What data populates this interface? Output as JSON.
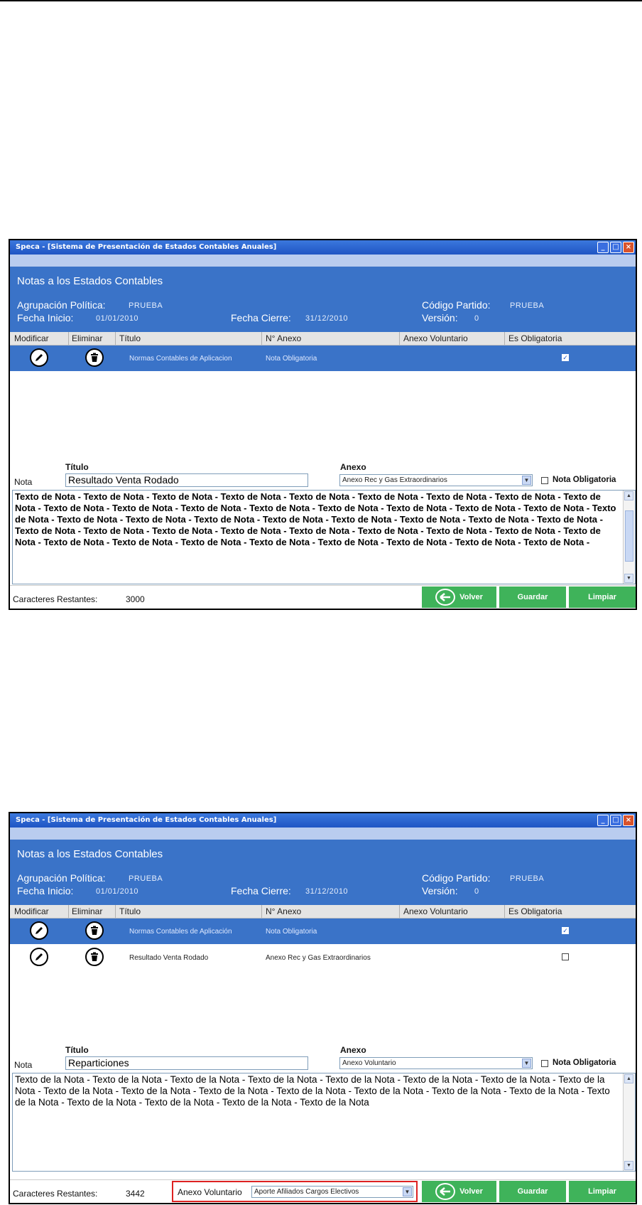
{
  "shot1": {
    "window_title": "Speca - [Sistema de Presentación de Estados Contables Anuales]",
    "header": {
      "title": "Notas a los Estados Contables",
      "agrupacion_label": "Agrupación Política:",
      "agrupacion_value": "PRUEBA",
      "codigo_label": "Código Partido:",
      "codigo_value": "PRUEBA",
      "fecha_inicio_label": "Fecha Inicio:",
      "fecha_inicio_value": "01/01/2010",
      "fecha_cierre_label": "Fecha Cierre:",
      "fecha_cierre_value": "31/12/2010",
      "version_label": "Versión:",
      "version_value": "0"
    },
    "columns": [
      "Modificar",
      "Eliminar",
      "Título",
      "N° Anexo",
      "Anexo Voluntario",
      "Es Obligatoria"
    ],
    "rows": [
      {
        "titulo": "Normas Contables de Aplicacion",
        "anexo": "Nota Obligatoria",
        "voluntario": "",
        "obligatoria": true
      }
    ],
    "form": {
      "titulo_label": "Título",
      "anexo_label": "Anexo",
      "nota_label": "Nota",
      "titulo_value": "Resultado Venta Rodado",
      "anexo_value": "Anexo Rec y Gas Extraordinarios",
      "obligatoria_label": "Nota Obligatoria",
      "text": "Texto de Nota - Texto de Nota - Texto de Nota - Texto de Nota - Texto de Nota - Texto de Nota - Texto de Nota - Texto de Nota - Texto de Nota - Texto de Nota - Texto de Nota - Texto de Nota - Texto de Nota - Texto de Nota - Texto de Nota - Texto de Nota - Texto de Nota - Texto de Nota - Texto de Nota - Texto de Nota - Texto de Nota - Texto de Nota - Texto de Nota - Texto de Nota - Texto de Nota - Texto de Nota - Texto de Nota - Texto de Nota - Texto de Nota - Texto de Nota - Texto de Nota - Texto de Nota - Texto de Nota - Texto de Nota - Texto de Nota - Texto de Nota - Texto de Nota - Texto de Nota - Texto de Nota - Texto de Nota - Texto de Nota - Texto de Nota - Texto de Nota -",
      "caracteres_label": "Caracteres Restantes:",
      "caracteres_value": "3000"
    },
    "buttons": {
      "volver": "Volver",
      "guardar": "Guardar",
      "limpiar": "Limpiar"
    }
  },
  "shot2": {
    "window_title": "Speca - [Sistema de Presentación de Estados Contables Anuales]",
    "header": {
      "title": "Notas a los Estados Contables",
      "agrupacion_label": "Agrupación Política:",
      "agrupacion_value": "PRUEBA",
      "codigo_label": "Código Partido:",
      "codigo_value": "PRUEBA",
      "fecha_inicio_label": "Fecha Inicio:",
      "fecha_inicio_value": "01/01/2010",
      "fecha_cierre_label": "Fecha Cierre:",
      "fecha_cierre_value": "31/12/2010",
      "version_label": "Versión:",
      "version_value": "0"
    },
    "columns": [
      "Modificar",
      "Eliminar",
      "Título",
      "N° Anexo",
      "Anexo Voluntario",
      "Es Obligatoria"
    ],
    "rows": [
      {
        "titulo": "Normas Contables de Aplicación",
        "anexo": "Nota Obligatoria",
        "voluntario": "",
        "obligatoria": true
      },
      {
        "titulo": "Resultado Venta Rodado",
        "anexo": "Anexo Rec y Gas Extraordinarios",
        "voluntario": "",
        "obligatoria": false
      }
    ],
    "form": {
      "titulo_label": "Título",
      "anexo_label": "Anexo",
      "nota_label": "Nota",
      "titulo_value": "Reparticiones",
      "anexo_value": "Anexo Voluntario",
      "obligatoria_label": "Nota Obligatoria",
      "text": "Texto de la Nota - Texto de la Nota - Texto de la Nota - Texto de la Nota - Texto de la Nota - Texto de la Nota - Texto de la Nota - Texto de la Nota - Texto de la Nota - Texto de la Nota - Texto de la Nota - Texto de la Nota - Texto de la Nota - Texto de la Nota - Texto de la Nota - Texto de la Nota - Texto de la Nota - Texto de la Nota - Texto de la Nota - Texto de la Nota",
      "caracteres_label": "Caracteres Restantes:",
      "caracteres_value": "3442",
      "anexo_voluntario_label": "Anexo Voluntario",
      "anexo_voluntario_value": "Aporte Afiliados Cargos Electivos"
    },
    "buttons": {
      "volver": "Volver",
      "guardar": "Guardar",
      "limpiar": "Limpiar"
    }
  }
}
